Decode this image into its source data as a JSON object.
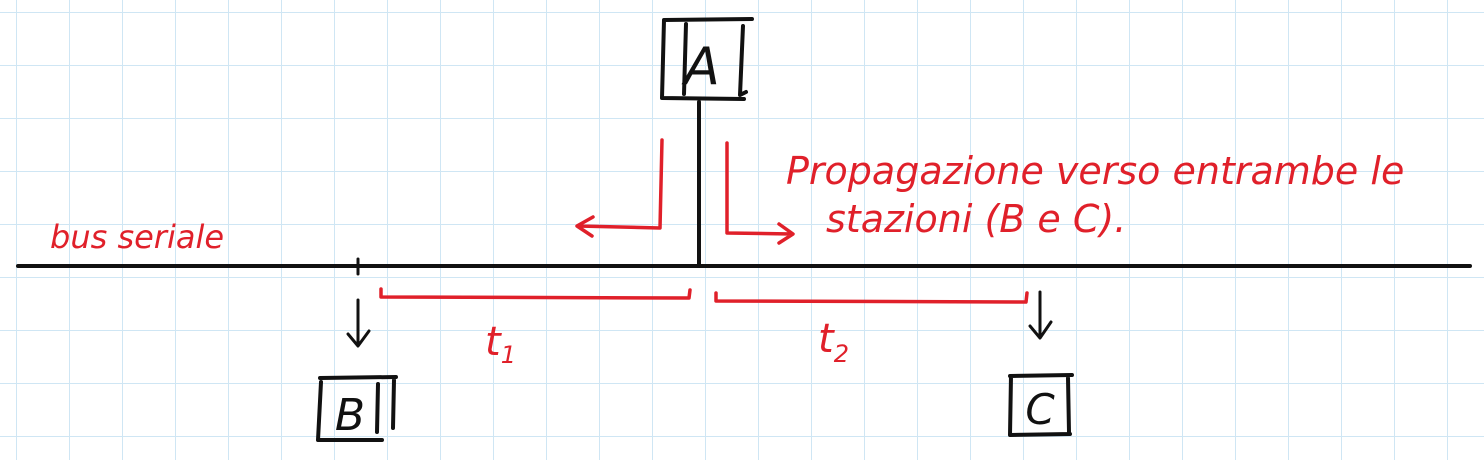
{
  "nodes": {
    "a": {
      "label": "A"
    },
    "b": {
      "label": "B"
    },
    "c": {
      "label": "C"
    }
  },
  "bus": {
    "label": "bus seriale"
  },
  "propagation": {
    "line1": "Propagazione verso entrambe le",
    "line2": "stazioni (B e C)."
  },
  "intervals": {
    "t1": {
      "label": "t",
      "subscript": "1"
    },
    "t2": {
      "label": "t",
      "subscript": "2"
    }
  },
  "colors": {
    "ink": "#111111",
    "annotation": "#e0202a",
    "grid": "#cfe6f4"
  }
}
